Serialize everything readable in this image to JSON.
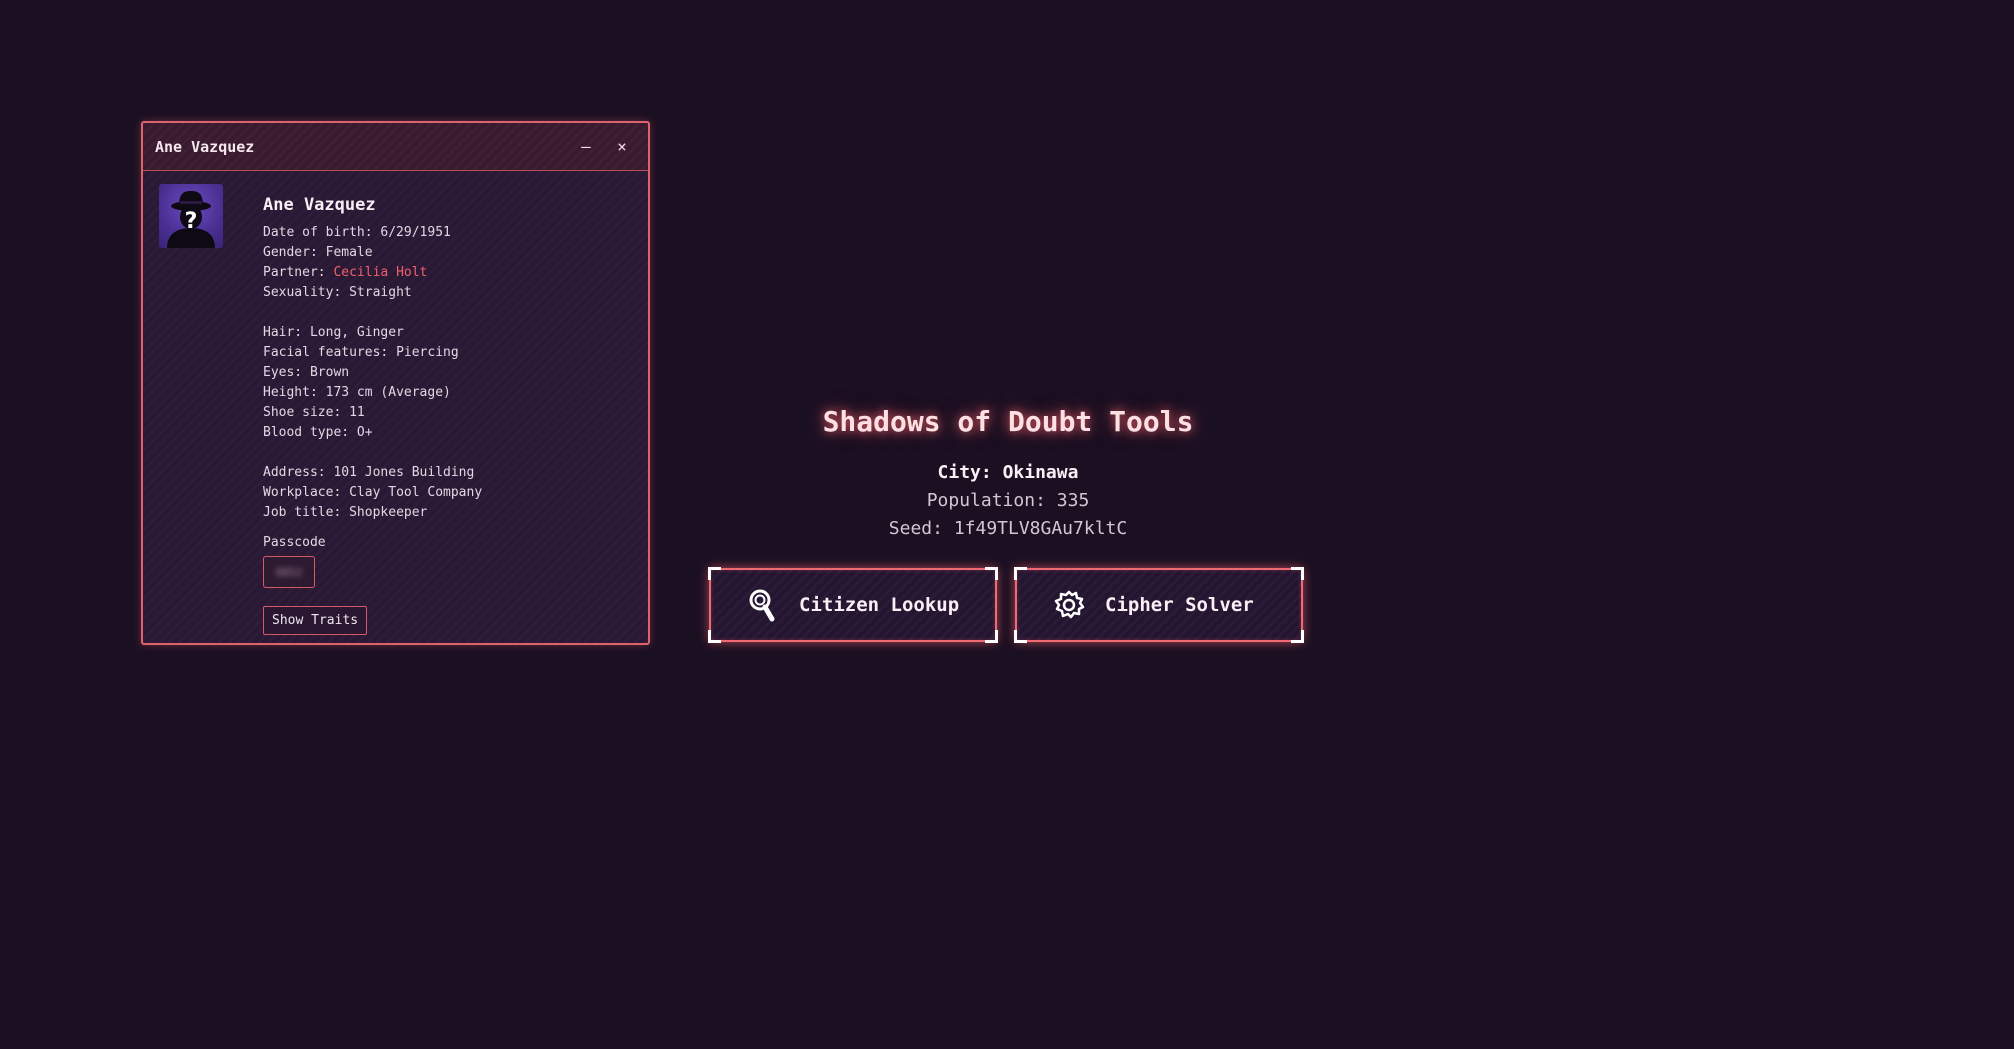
{
  "window": {
    "title": "Ane Vazquez",
    "minimize_label": "–",
    "close_label": "×",
    "avatar_icon": "unknown-person-fedora-icon",
    "avatar_glyph": "?",
    "citizen": {
      "name": "Ane Vazquez",
      "dob_label": "Date of birth:",
      "dob": "6/29/1951",
      "gender_label": "Gender:",
      "gender": "Female",
      "partner_label": "Partner:",
      "partner": "Cecilia Holt",
      "sexuality_label": "Sexuality:",
      "sexuality": "Straight",
      "hair_label": "Hair:",
      "hair": "Long, Ginger",
      "facial_label": "Facial features:",
      "facial": "Piercing",
      "eyes_label": "Eyes:",
      "eyes": "Brown",
      "height_label": "Height:",
      "height": "173 cm (Average)",
      "shoe_label": "Shoe size:",
      "shoe": "11",
      "blood_label": "Blood type:",
      "blood": "O+",
      "address_label": "Address:",
      "address": "101 Jones Building",
      "workplace_label": "Workplace:",
      "workplace": "Clay Tool Company",
      "job_label": "Job title:",
      "job": "Shopkeeper"
    },
    "passcode_label": "Passcode",
    "passcode_value": "8852",
    "traits_button": "Show Traits"
  },
  "hub": {
    "title": "Shadows of Doubt Tools",
    "city_label": "City:",
    "city": "Okinawa",
    "population_label": "Population:",
    "population": "335",
    "seed_label": "Seed:",
    "seed": "1f49TLV8GAu7kltC",
    "tools": [
      {
        "label": "Citizen Lookup",
        "icon": "magnifier-search-icon"
      },
      {
        "label": "Cipher Solver",
        "icon": "brain-gear-icon"
      }
    ]
  },
  "colors": {
    "background": "#1b1022",
    "accent": "#f0606a",
    "window_bg": "#2a1935"
  }
}
